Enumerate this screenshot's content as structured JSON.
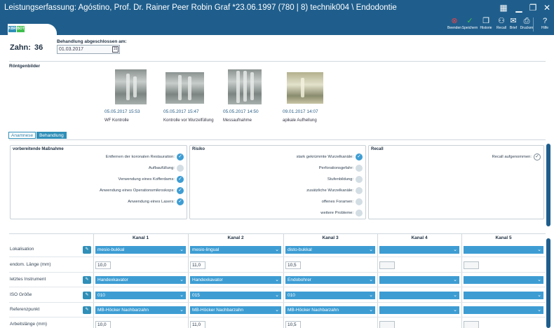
{
  "window": {
    "title": "Leistungserfassung: Agóstino, Prof. Dr. Rainer Peer Robin Graf *23.06.1997 (780 | 8) technik004 \\ Endodontie"
  },
  "toolbar": {
    "badges": [
      "KBR",
      "BOT"
    ],
    "buttons": [
      {
        "label": "Beenden",
        "icon": "cancel-icon",
        "glyph": "⊗",
        "color": "#e8424a"
      },
      {
        "label": "Speichern",
        "icon": "save-check-icon",
        "glyph": "✓",
        "color": "#3fbf4f"
      },
      {
        "label": "Historie",
        "icon": "history-icon",
        "glyph": "❐"
      },
      {
        "label": "Recall",
        "icon": "recall-icon",
        "glyph": "⚇"
      },
      {
        "label": "Brief",
        "icon": "letter-icon",
        "glyph": "✉"
      },
      {
        "label": "Drucken",
        "icon": "print-icon",
        "glyph": "⎙"
      },
      {
        "label": "Hilfe",
        "icon": "help-icon",
        "glyph": "?"
      }
    ]
  },
  "header": {
    "zahn_label": "Zahn:",
    "zahn_value": "36",
    "behandlung_label": "Behandlung abgeschlossen am:",
    "behandlung_date": "01.03.2017"
  },
  "roentgen": {
    "title": "Röntgenbilder",
    "images": [
      {
        "date": "05.05.2017 15:53",
        "caption": "WF Kontrolle"
      },
      {
        "date": "05.05.2017 15:47",
        "caption": "Kontrolle vor Wurzelfüllung"
      },
      {
        "date": "05.05.2017 14:50",
        "caption": "Messaufnahme"
      },
      {
        "date": "09.01.2017 14:07",
        "caption": "apikale Aufhellung"
      }
    ]
  },
  "tabs": [
    {
      "label": "Anamnese",
      "active": false
    },
    {
      "label": "Behandlung",
      "active": true
    }
  ],
  "panels": {
    "vorbereitende": {
      "title": "vorbereitende Maßnahme",
      "items": [
        {
          "label": "Entfernen der koronalen Restauration:",
          "checked": true
        },
        {
          "label": "Aufbaufüllung:",
          "checked": false
        },
        {
          "label": "Verwendung eines Kofferdams:",
          "checked": true
        },
        {
          "label": "Anwendung eines Operationsmikroskops:",
          "checked": true
        },
        {
          "label": "Anwendung eines Lasers:",
          "checked": true
        }
      ]
    },
    "risiko": {
      "title": "Risiko",
      "items": [
        {
          "label": "stark gekrümmte Wurzelkanäle:",
          "checked": true
        },
        {
          "label": "Perforationsgefahr:",
          "checked": false
        },
        {
          "label": "Stufenbildung:",
          "checked": false
        },
        {
          "label": "zusätzliche Wurzelkanäle:",
          "checked": false
        },
        {
          "label": "offenes Foramen:",
          "checked": false
        },
        {
          "label": "weitere Probleme:",
          "checked": false
        }
      ]
    },
    "recall": {
      "title": "Recall",
      "items": [
        {
          "label": "Recall aufgenommen:",
          "checked": true
        }
      ]
    }
  },
  "kanal_table": {
    "columns": [
      "Kanal 1",
      "Kanal 2",
      "Kanal 3",
      "Kanal 4",
      "Kanal 5"
    ],
    "rows": [
      {
        "label": "Lokalisation",
        "type": "select",
        "values": [
          "mesio-bukkal",
          "mesio-lingual",
          "disto-bukkal",
          "",
          ""
        ]
      },
      {
        "label": "endom. Länge (mm)",
        "type": "input",
        "values": [
          "10,0",
          "11,0",
          "10,5",
          "",
          ""
        ]
      },
      {
        "label": "letztes Instrument",
        "type": "select",
        "values": [
          "Handexkavator",
          "Handexkavator",
          "Endobohrer",
          "",
          ""
        ]
      },
      {
        "label": "ISO Größe",
        "type": "select",
        "values": [
          "010",
          "015",
          "010",
          "",
          ""
        ]
      },
      {
        "label": "Referenzpunkt",
        "type": "select",
        "values": [
          "MB-Höcker Nachbarzahn",
          "MB-Höcker Nachbarzahn",
          "MB-Höcker Nachbarzahn",
          "",
          ""
        ]
      },
      {
        "label": "Arbeitslänge (mm)",
        "type": "input",
        "values": [
          "10,0",
          "11,0",
          "10,5",
          "",
          ""
        ]
      }
    ]
  }
}
